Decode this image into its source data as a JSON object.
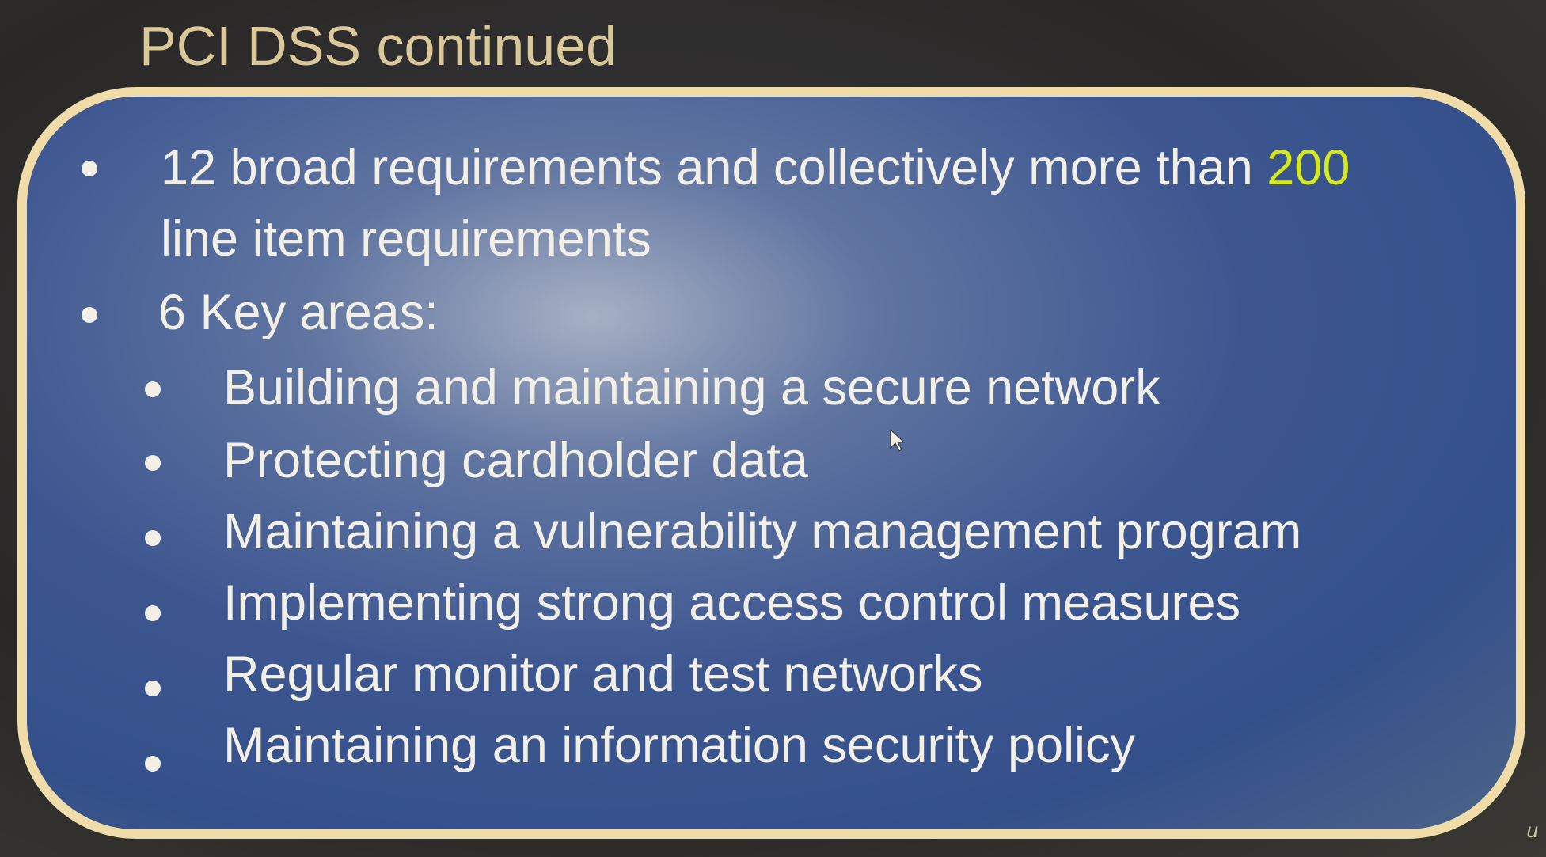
{
  "slide": {
    "title": "PCI DSS continued",
    "bullets": [
      {
        "text_before": "12 broad requirements and collectively more than ",
        "highlight": "200",
        "text_line2": "line item requirements"
      },
      {
        "text": "6 Key areas:"
      }
    ],
    "sub_bullets": [
      "Building and maintaining a secure network",
      "Protecting cardholder data",
      "Maintaining a vulnerability management program",
      "Implementing strong access control measures",
      "Regular monitor and test networks",
      "Maintaining an information security policy"
    ],
    "highlight_color": "#d4e81c",
    "border_color": "#f0dca8",
    "corner_mark": "u"
  }
}
